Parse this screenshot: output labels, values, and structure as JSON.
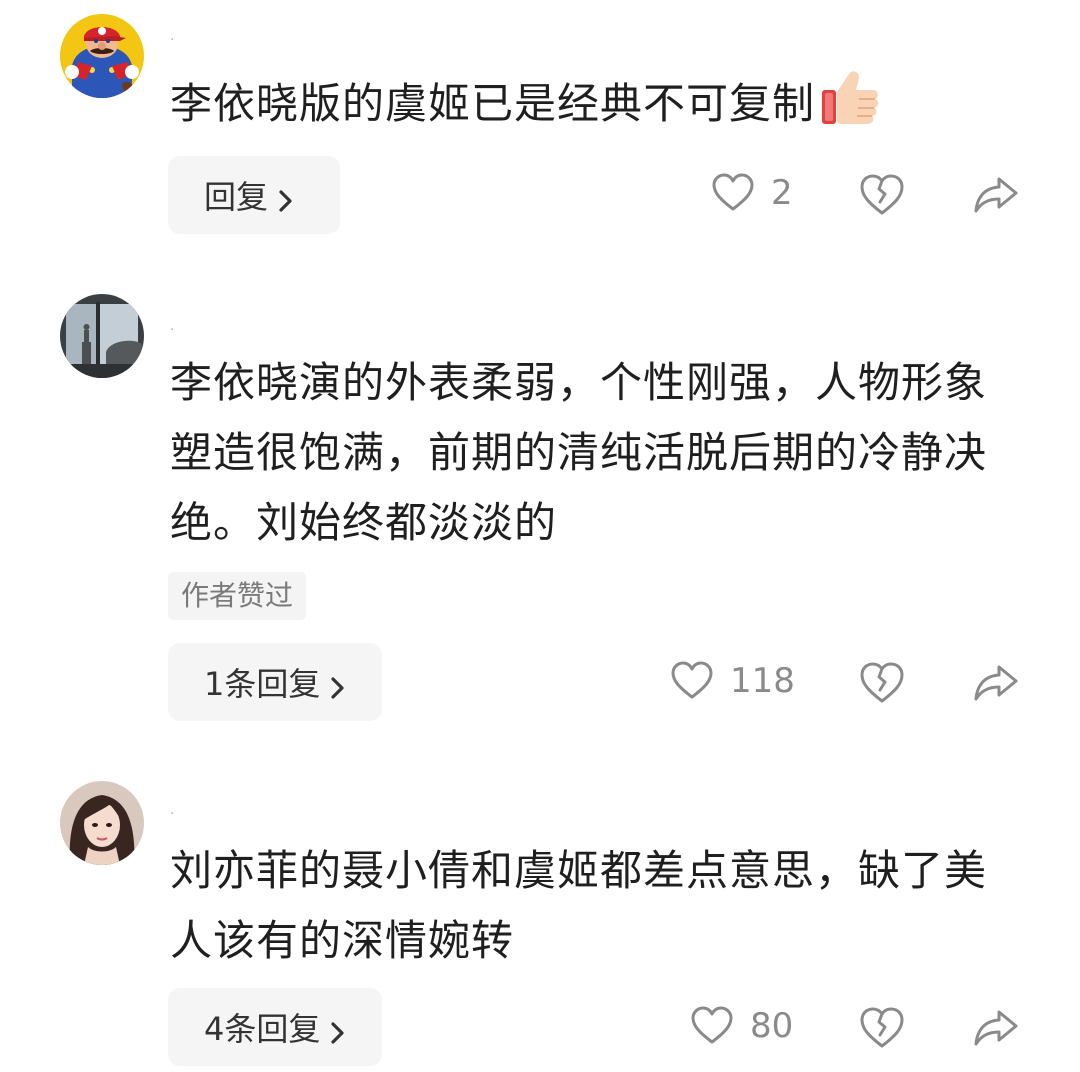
{
  "comments": [
    {
      "username": "·",
      "avatar": "mario-avatar",
      "text": "李依晓版的虞姬已是经典不可复制",
      "emoji": "thumbs-up-icon",
      "reply_label": "回复",
      "like_count": "2"
    },
    {
      "username": "·",
      "avatar": "window-scene-avatar",
      "text": "李依晓演的外表柔弱，个性刚强，人物形象塑造很饱满，前期的清纯活脱后期的冷静决绝。刘始终都淡淡的",
      "badge": "作者赞过",
      "reply_label": "1条回复",
      "like_count": "118"
    },
    {
      "username": "·",
      "avatar": "portrait-avatar",
      "text": "刘亦菲的聂小倩和虞姬都差点意思，缺了美人该有的深情婉转",
      "reply_label": "4条回复",
      "like_count": "80"
    }
  ],
  "icons": {
    "like": "heart-outline-icon",
    "dislike": "broken-heart-icon",
    "share": "share-arrow-icon",
    "chevron": "chevron-right-icon"
  },
  "colors": {
    "text": "#1f1f1f",
    "muted": "#8a8a8a",
    "button_bg": "#f5f5f5"
  }
}
